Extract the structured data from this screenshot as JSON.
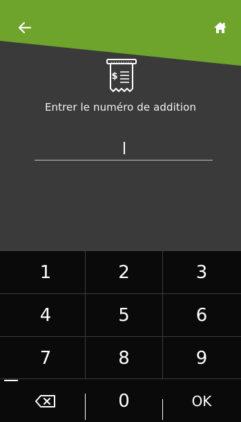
{
  "header": {
    "accent_color": "#6ea32c",
    "back_icon": "arrow-left-icon",
    "home_icon": "home-icon"
  },
  "main": {
    "icon": "receipt-dollar-icon",
    "prompt": "Entrer le numéro de addition",
    "input_value": ""
  },
  "keypad": {
    "keys": [
      "1",
      "2",
      "3",
      "4",
      "5",
      "6",
      "7",
      "8",
      "9"
    ],
    "backspace_icon": "backspace-icon",
    "zero": "0",
    "ok": "OK"
  }
}
